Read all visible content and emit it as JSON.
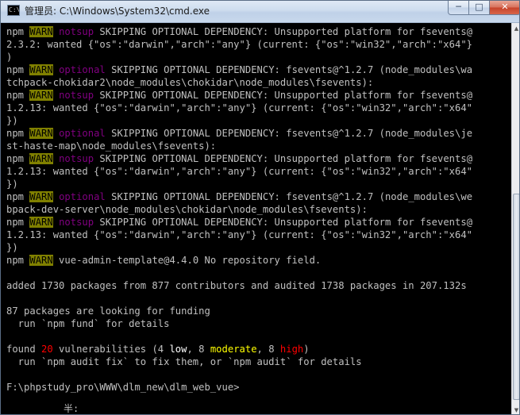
{
  "window": {
    "title": "管理员: C:\\Windows\\System32\\cmd.exe",
    "icon": "C:\\",
    "minimize": "─",
    "maximize": "□",
    "close": "✕"
  },
  "lines": [
    {
      "segs": [
        {
          "t": "npm ",
          "c": "gray"
        },
        {
          "t": "WARN",
          "c": "warn"
        },
        {
          "t": " ",
          "c": "gray"
        },
        {
          "t": "notsup",
          "c": "magenta"
        },
        {
          "t": " SKIPPING OPTIONAL DEPENDENCY: Unsupported platform for fsevents@",
          "c": "gray"
        }
      ]
    },
    {
      "segs": [
        {
          "t": "2.3.2: wanted {\"os\":\"darwin\",\"arch\":\"any\"} (current: {\"os\":\"win32\",\"arch\":\"x64\"}",
          "c": "gray"
        }
      ]
    },
    {
      "segs": [
        {
          "t": ")",
          "c": "gray"
        }
      ]
    },
    {
      "segs": [
        {
          "t": "npm ",
          "c": "gray"
        },
        {
          "t": "WARN",
          "c": "warn"
        },
        {
          "t": " ",
          "c": "gray"
        },
        {
          "t": "optional",
          "c": "magenta"
        },
        {
          "t": " SKIPPING OPTIONAL DEPENDENCY: fsevents@^1.2.7 (node_modules\\wa",
          "c": "gray"
        }
      ]
    },
    {
      "segs": [
        {
          "t": "tchpack-chokidar2\\node_modules\\chokidar\\node_modules\\fsevents):",
          "c": "gray"
        }
      ]
    },
    {
      "segs": [
        {
          "t": "npm ",
          "c": "gray"
        },
        {
          "t": "WARN",
          "c": "warn"
        },
        {
          "t": " ",
          "c": "gray"
        },
        {
          "t": "notsup",
          "c": "magenta"
        },
        {
          "t": " SKIPPING OPTIONAL DEPENDENCY: Unsupported platform for fsevents@",
          "c": "gray"
        }
      ]
    },
    {
      "segs": [
        {
          "t": "1.2.13: wanted {\"os\":\"darwin\",\"arch\":\"any\"} (current: {\"os\":\"win32\",\"arch\":\"x64\"",
          "c": "gray"
        }
      ]
    },
    {
      "segs": [
        {
          "t": "})",
          "c": "gray"
        }
      ]
    },
    {
      "segs": [
        {
          "t": "npm ",
          "c": "gray"
        },
        {
          "t": "WARN",
          "c": "warn"
        },
        {
          "t": " ",
          "c": "gray"
        },
        {
          "t": "optional",
          "c": "magenta"
        },
        {
          "t": " SKIPPING OPTIONAL DEPENDENCY: fsevents@^1.2.7 (node_modules\\je",
          "c": "gray"
        }
      ]
    },
    {
      "segs": [
        {
          "t": "st-haste-map\\node_modules\\fsevents):",
          "c": "gray"
        }
      ]
    },
    {
      "segs": [
        {
          "t": "npm ",
          "c": "gray"
        },
        {
          "t": "WARN",
          "c": "warn"
        },
        {
          "t": " ",
          "c": "gray"
        },
        {
          "t": "notsup",
          "c": "magenta"
        },
        {
          "t": " SKIPPING OPTIONAL DEPENDENCY: Unsupported platform for fsevents@",
          "c": "gray"
        }
      ]
    },
    {
      "segs": [
        {
          "t": "1.2.13: wanted {\"os\":\"darwin\",\"arch\":\"any\"} (current: {\"os\":\"win32\",\"arch\":\"x64\"",
          "c": "gray"
        }
      ]
    },
    {
      "segs": [
        {
          "t": "})",
          "c": "gray"
        }
      ]
    },
    {
      "segs": [
        {
          "t": "npm ",
          "c": "gray"
        },
        {
          "t": "WARN",
          "c": "warn"
        },
        {
          "t": " ",
          "c": "gray"
        },
        {
          "t": "optional",
          "c": "magenta"
        },
        {
          "t": " SKIPPING OPTIONAL DEPENDENCY: fsevents@^1.2.7 (node_modules\\we",
          "c": "gray"
        }
      ]
    },
    {
      "segs": [
        {
          "t": "bpack-dev-server\\node_modules\\chokidar\\node_modules\\fsevents):",
          "c": "gray"
        }
      ]
    },
    {
      "segs": [
        {
          "t": "npm ",
          "c": "gray"
        },
        {
          "t": "WARN",
          "c": "warn"
        },
        {
          "t": " ",
          "c": "gray"
        },
        {
          "t": "notsup",
          "c": "magenta"
        },
        {
          "t": " SKIPPING OPTIONAL DEPENDENCY: Unsupported platform for fsevents@",
          "c": "gray"
        }
      ]
    },
    {
      "segs": [
        {
          "t": "1.2.13: wanted {\"os\":\"darwin\",\"arch\":\"any\"} (current: {\"os\":\"win32\",\"arch\":\"x64\"",
          "c": "gray"
        }
      ]
    },
    {
      "segs": [
        {
          "t": "})",
          "c": "gray"
        }
      ]
    },
    {
      "segs": [
        {
          "t": "npm ",
          "c": "gray"
        },
        {
          "t": "WARN",
          "c": "warn"
        },
        {
          "t": " vue-admin-template@4.4.0 No repository field.",
          "c": "gray"
        }
      ]
    },
    {
      "segs": []
    },
    {
      "segs": [
        {
          "t": "added 1730 packages from 877 contributors and audited 1738 packages in 207.132s",
          "c": "gray"
        }
      ]
    },
    {
      "segs": []
    },
    {
      "segs": [
        {
          "t": "87 packages are looking for funding",
          "c": "gray"
        }
      ]
    },
    {
      "segs": [
        {
          "t": "  run `npm fund` for details",
          "c": "gray"
        }
      ]
    },
    {
      "segs": []
    },
    {
      "segs": [
        {
          "t": "found ",
          "c": "gray"
        },
        {
          "t": "20",
          "c": "red"
        },
        {
          "t": " vulnerabilities (4 ",
          "c": "gray"
        },
        {
          "t": "low",
          "c": "white"
        },
        {
          "t": ", 8 ",
          "c": "gray"
        },
        {
          "t": "moderate",
          "c": "yellow"
        },
        {
          "t": ", 8 ",
          "c": "gray"
        },
        {
          "t": "high",
          "c": "red"
        },
        {
          "t": ")",
          "c": "gray"
        }
      ]
    },
    {
      "segs": [
        {
          "t": "  run `npm audit fix` to fix them, or `npm audit` for details",
          "c": "gray"
        }
      ]
    },
    {
      "segs": []
    },
    {
      "segs": [
        {
          "t": "F:\\phpstudy_pro\\WWW\\dlm_new\\dlm_web_vue>",
          "c": "gray"
        }
      ]
    }
  ],
  "ime_indicator": "半:",
  "colors": {
    "gray": "#c0c0c0",
    "white": "#ffffff",
    "magenta": "#800080",
    "red": "#ff0000",
    "yellow": "#ffff00",
    "warn_bg": "#808000"
  }
}
